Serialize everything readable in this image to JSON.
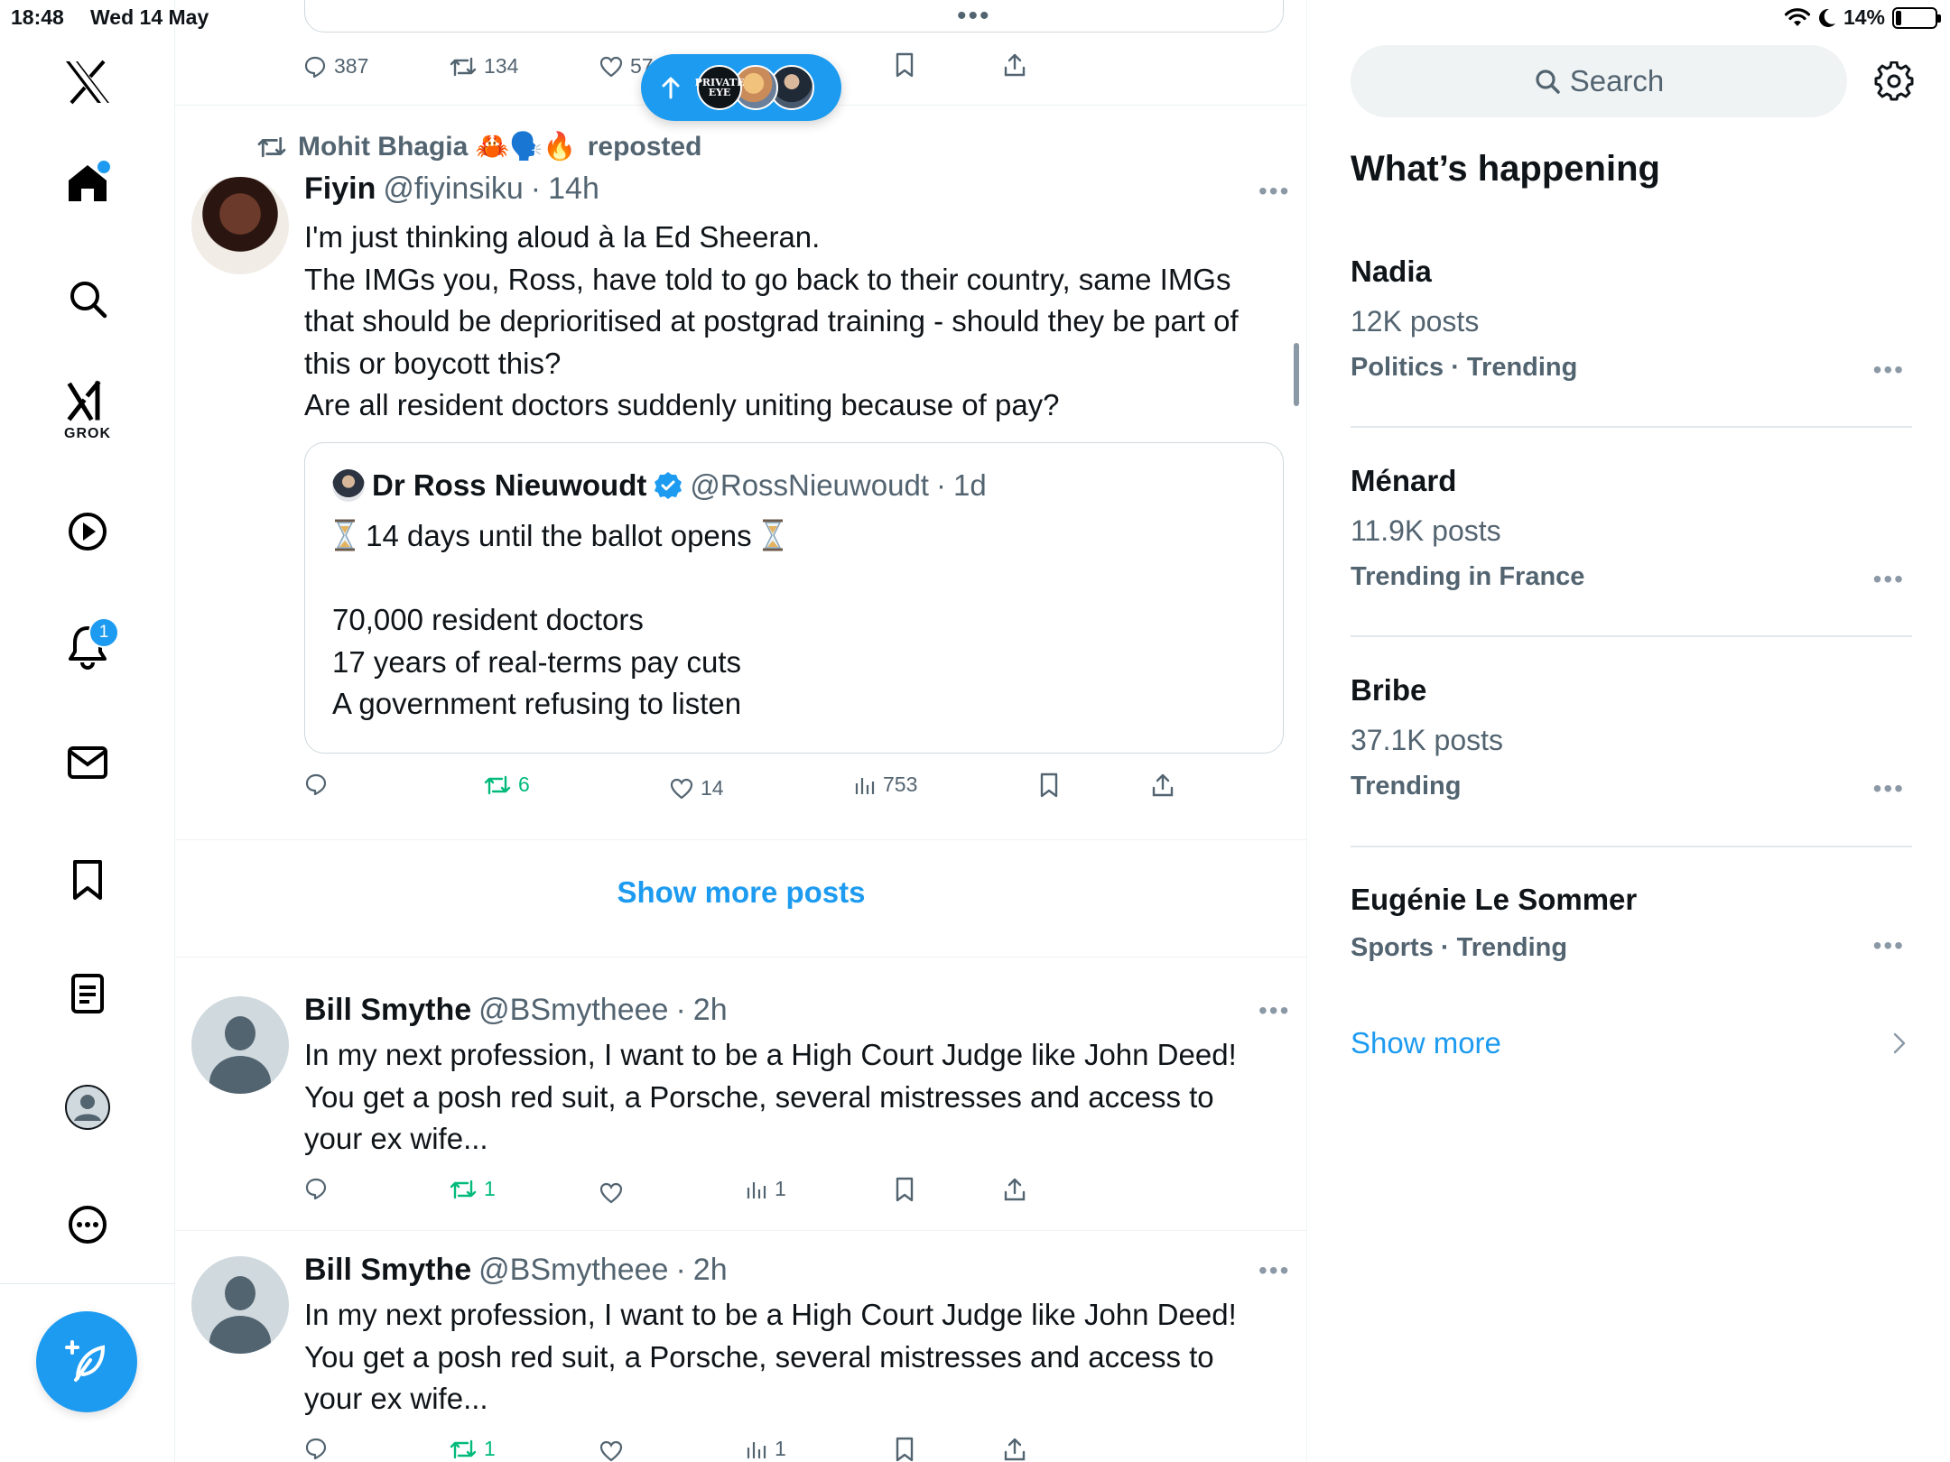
{
  "status_bar": {
    "time": "18:48",
    "date": "Wed 14 May",
    "battery_percent_label": "14%",
    "battery_level": 0.14
  },
  "nav": {
    "logo": "x-logo-icon",
    "items": [
      {
        "icon": "home-icon",
        "active": true
      },
      {
        "icon": "search-icon"
      },
      {
        "icon": "grok-icon",
        "label": "GROK"
      },
      {
        "icon": "video-play-icon"
      },
      {
        "icon": "bell-icon",
        "badge": "1"
      },
      {
        "icon": "mail-icon"
      },
      {
        "icon": "bookmark-icon"
      },
      {
        "icon": "lists-icon"
      },
      {
        "icon": "profile-icon"
      },
      {
        "icon": "more-circle-icon"
      }
    ],
    "compose_icon": "compose-feather-icon"
  },
  "feed": {
    "previous_tweet_actions": {
      "replies": "387",
      "reposts": "134",
      "likes": "57"
    },
    "new_posts_pill": {
      "icon": "arrow-up-icon",
      "avatar1_label": "PRIVATE EYE"
    },
    "tweet1": {
      "repost_by": "Mohit Bhagia 🦀🗣️🔥",
      "repost_suffix": "reposted",
      "name": "Fiyin",
      "handle": "@fiyinsiku",
      "time": "14h",
      "lines": [
        "I'm just thinking aloud à la Ed Sheeran.",
        "The IMGs you, Ross, have told to go back to their country, same IMGs",
        "that should be deprioritised at postgrad training - should they be part of",
        "this or boycott this?",
        "Are all resident doctors suddenly uniting because of pay?"
      ],
      "quote": {
        "name": "Dr Ross Nieuwoudt",
        "handle": "@RossNieuwoudt",
        "time": "1d",
        "line1": "14 days until the ballot opens",
        "line2": "70,000 resident doctors",
        "line3": "17 years of real-terms pay cuts",
        "line4": "A government refusing to listen"
      },
      "reposts": "6",
      "likes": "14",
      "views": "753"
    },
    "show_more_posts": "Show more posts",
    "tweet2": {
      "name": "Bill Smythe",
      "handle": "@BSmytheee",
      "time": "2h",
      "lines": [
        "In my next profession, I want to be a High Court Judge like John Deed!",
        "You get a posh red suit, a Porsche, several mistresses and access to",
        "your ex wife..."
      ],
      "reposts": "1",
      "views": "1"
    },
    "tweet3": {
      "name": "Bill Smythe",
      "handle": "@BSmytheee",
      "time": "2h",
      "lines": [
        "In my next profession, I want to be a High Court Judge like John Deed!",
        "You get a posh red suit, a Porsche, several mistresses and access to",
        "your ex wife..."
      ],
      "reposts": "1",
      "views": "1"
    }
  },
  "sidebar": {
    "search_placeholder": "Search",
    "title": "What’s happening",
    "trends": [
      {
        "name": "Nadia",
        "posts": "12K posts",
        "context": "Politics · Trending"
      },
      {
        "name": "Ménard",
        "posts": "11.9K posts",
        "context": "Trending in France"
      },
      {
        "name": "Bribe",
        "posts": "37.1K posts",
        "context": "Trending"
      },
      {
        "name": "Eugénie Le Sommer",
        "context": "Sports · Trending"
      }
    ],
    "show_more": "Show more"
  },
  "colors": {
    "accent": "#1d9bf0",
    "text": "#0f1419",
    "muted": "#536471",
    "repost_green": "#00ba7c",
    "border": "#eff3f4"
  }
}
